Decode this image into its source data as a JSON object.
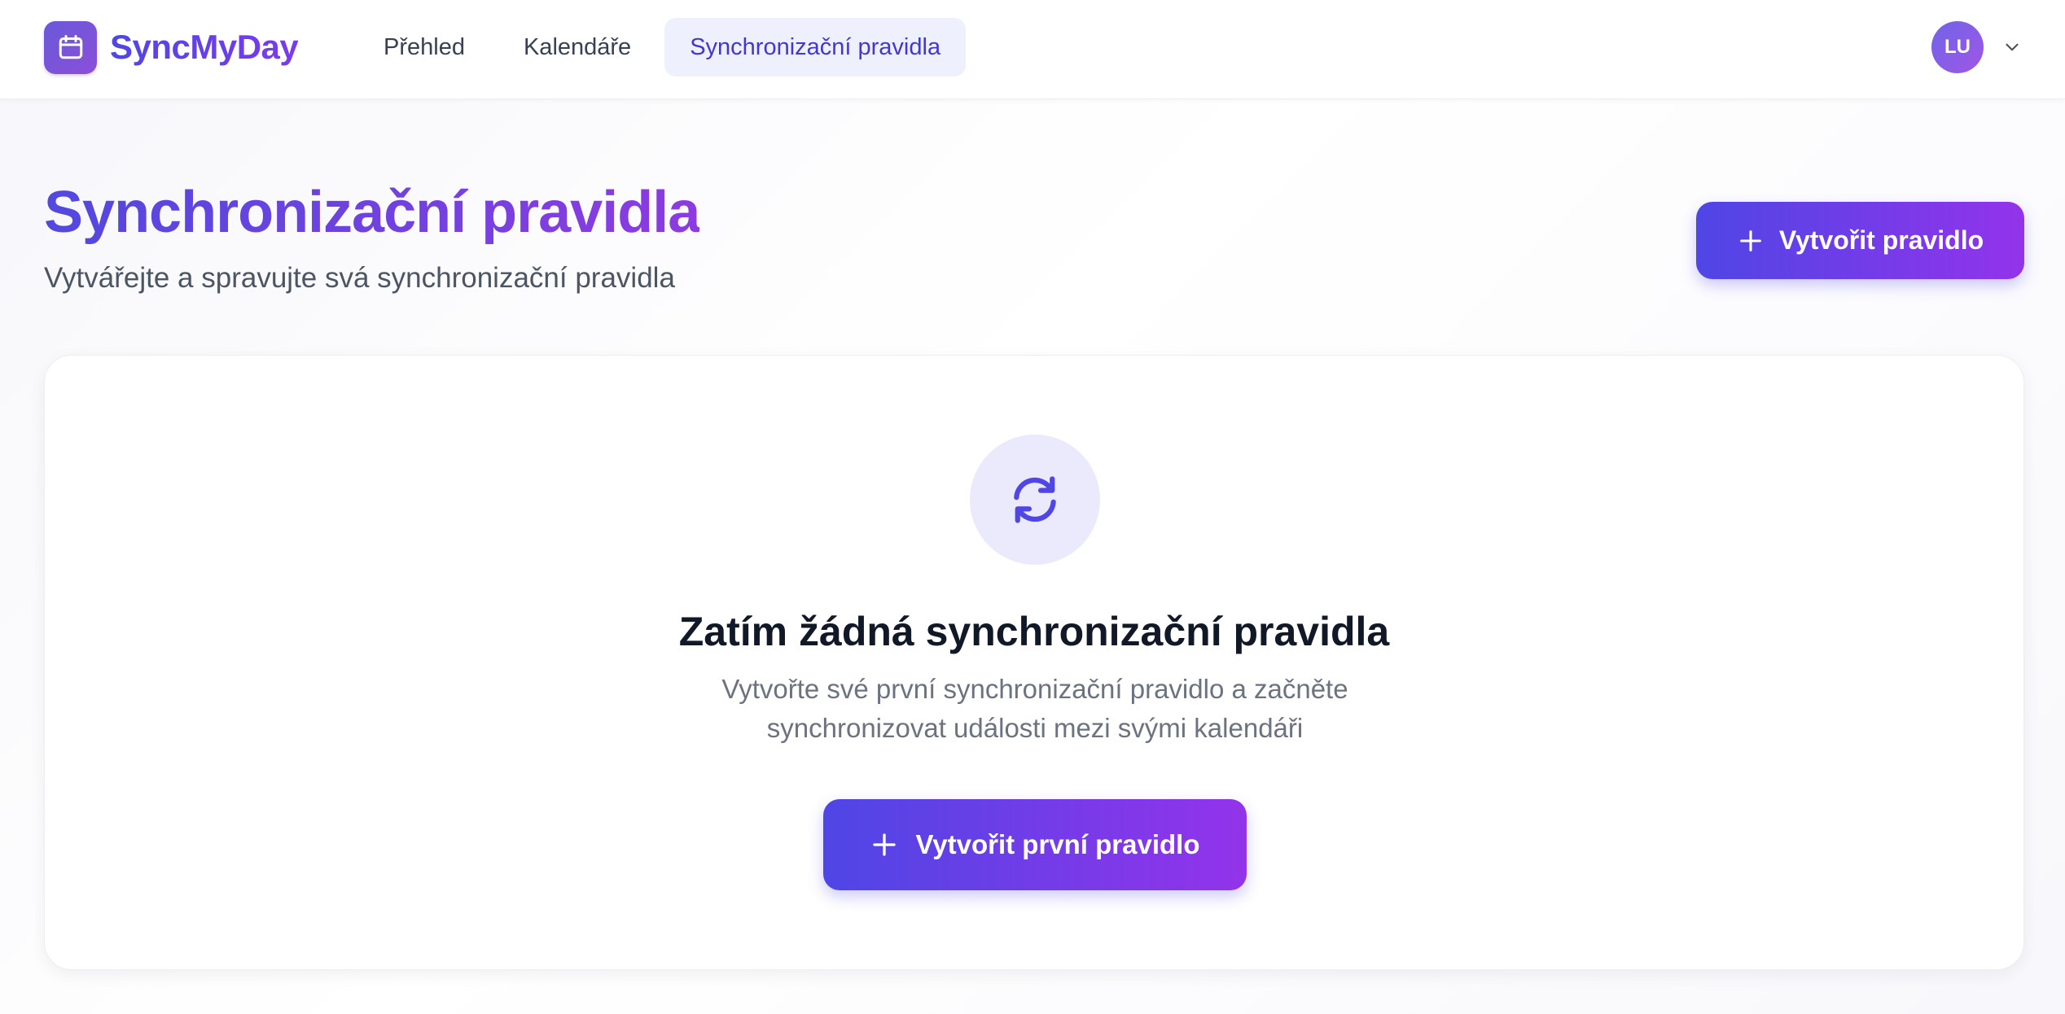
{
  "app": {
    "name": "SyncMyDay",
    "accent_color": "#4f46e5",
    "accent_color_end": "#9333ea"
  },
  "nav": {
    "items": [
      {
        "label": "Přehled",
        "active": false
      },
      {
        "label": "Kalendáře",
        "active": false
      },
      {
        "label": "Synchronizační pravidla",
        "active": true
      }
    ]
  },
  "user": {
    "initials": "LU",
    "menu_icon": "chevron-down-icon"
  },
  "page": {
    "title": "Synchronizační pravidla",
    "subtitle": "Vytvářejte a spravujte svá synchronizační pravidla",
    "create_button": {
      "label": "Vytvořit pravidlo",
      "icon": "plus-icon"
    }
  },
  "empty_state": {
    "icon": "sync-icon",
    "title": "Zatím žádná synchronizační pravidla",
    "description": "Vytvořte své první synchronizační pravidlo a začněte synchronizovat události mezi svými kalendáři",
    "button": {
      "label": "Vytvořit první pravidlo",
      "icon": "plus-icon"
    }
  }
}
